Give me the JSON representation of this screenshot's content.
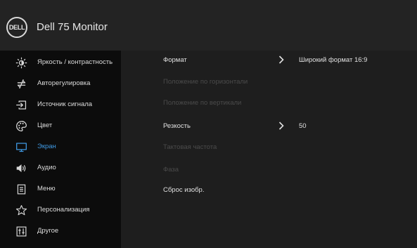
{
  "header": {
    "logo_text": "DELL",
    "title": "Dell 75 Monitor"
  },
  "sidebar": {
    "items": [
      {
        "label": "Яркость / контрастность",
        "icon": "brightness-icon"
      },
      {
        "label": "Авторегулировка",
        "icon": "auto-adjust-icon"
      },
      {
        "label": "Источник сигнала",
        "icon": "input-source-icon"
      },
      {
        "label": "Цвет",
        "icon": "color-palette-icon"
      },
      {
        "label": "Экран",
        "icon": "display-icon",
        "active": true
      },
      {
        "label": "Аудио",
        "icon": "speaker-icon"
      },
      {
        "label": "Меню",
        "icon": "menu-icon"
      },
      {
        "label": "Персонализация",
        "icon": "star-icon"
      },
      {
        "label": "Другое",
        "icon": "other-settings-icon"
      }
    ]
  },
  "panel": {
    "rows": [
      {
        "label": "Формат",
        "value": "Широкий формат 16:9",
        "enabled": true
      },
      {
        "label": "Положение по горизонтали",
        "enabled": false
      },
      {
        "label": "Положение по вертикали",
        "enabled": false
      },
      {
        "label": "Резкость",
        "value": "50",
        "enabled": true
      },
      {
        "label": "Тактовая частота",
        "enabled": false
      },
      {
        "label": "Фаза",
        "enabled": false
      },
      {
        "label": "Сброс изобр.",
        "enabled": true
      }
    ]
  },
  "colors": {
    "active": "#3f99e3",
    "text": "#dcdcdc",
    "disabled": "#4b4b4b"
  }
}
